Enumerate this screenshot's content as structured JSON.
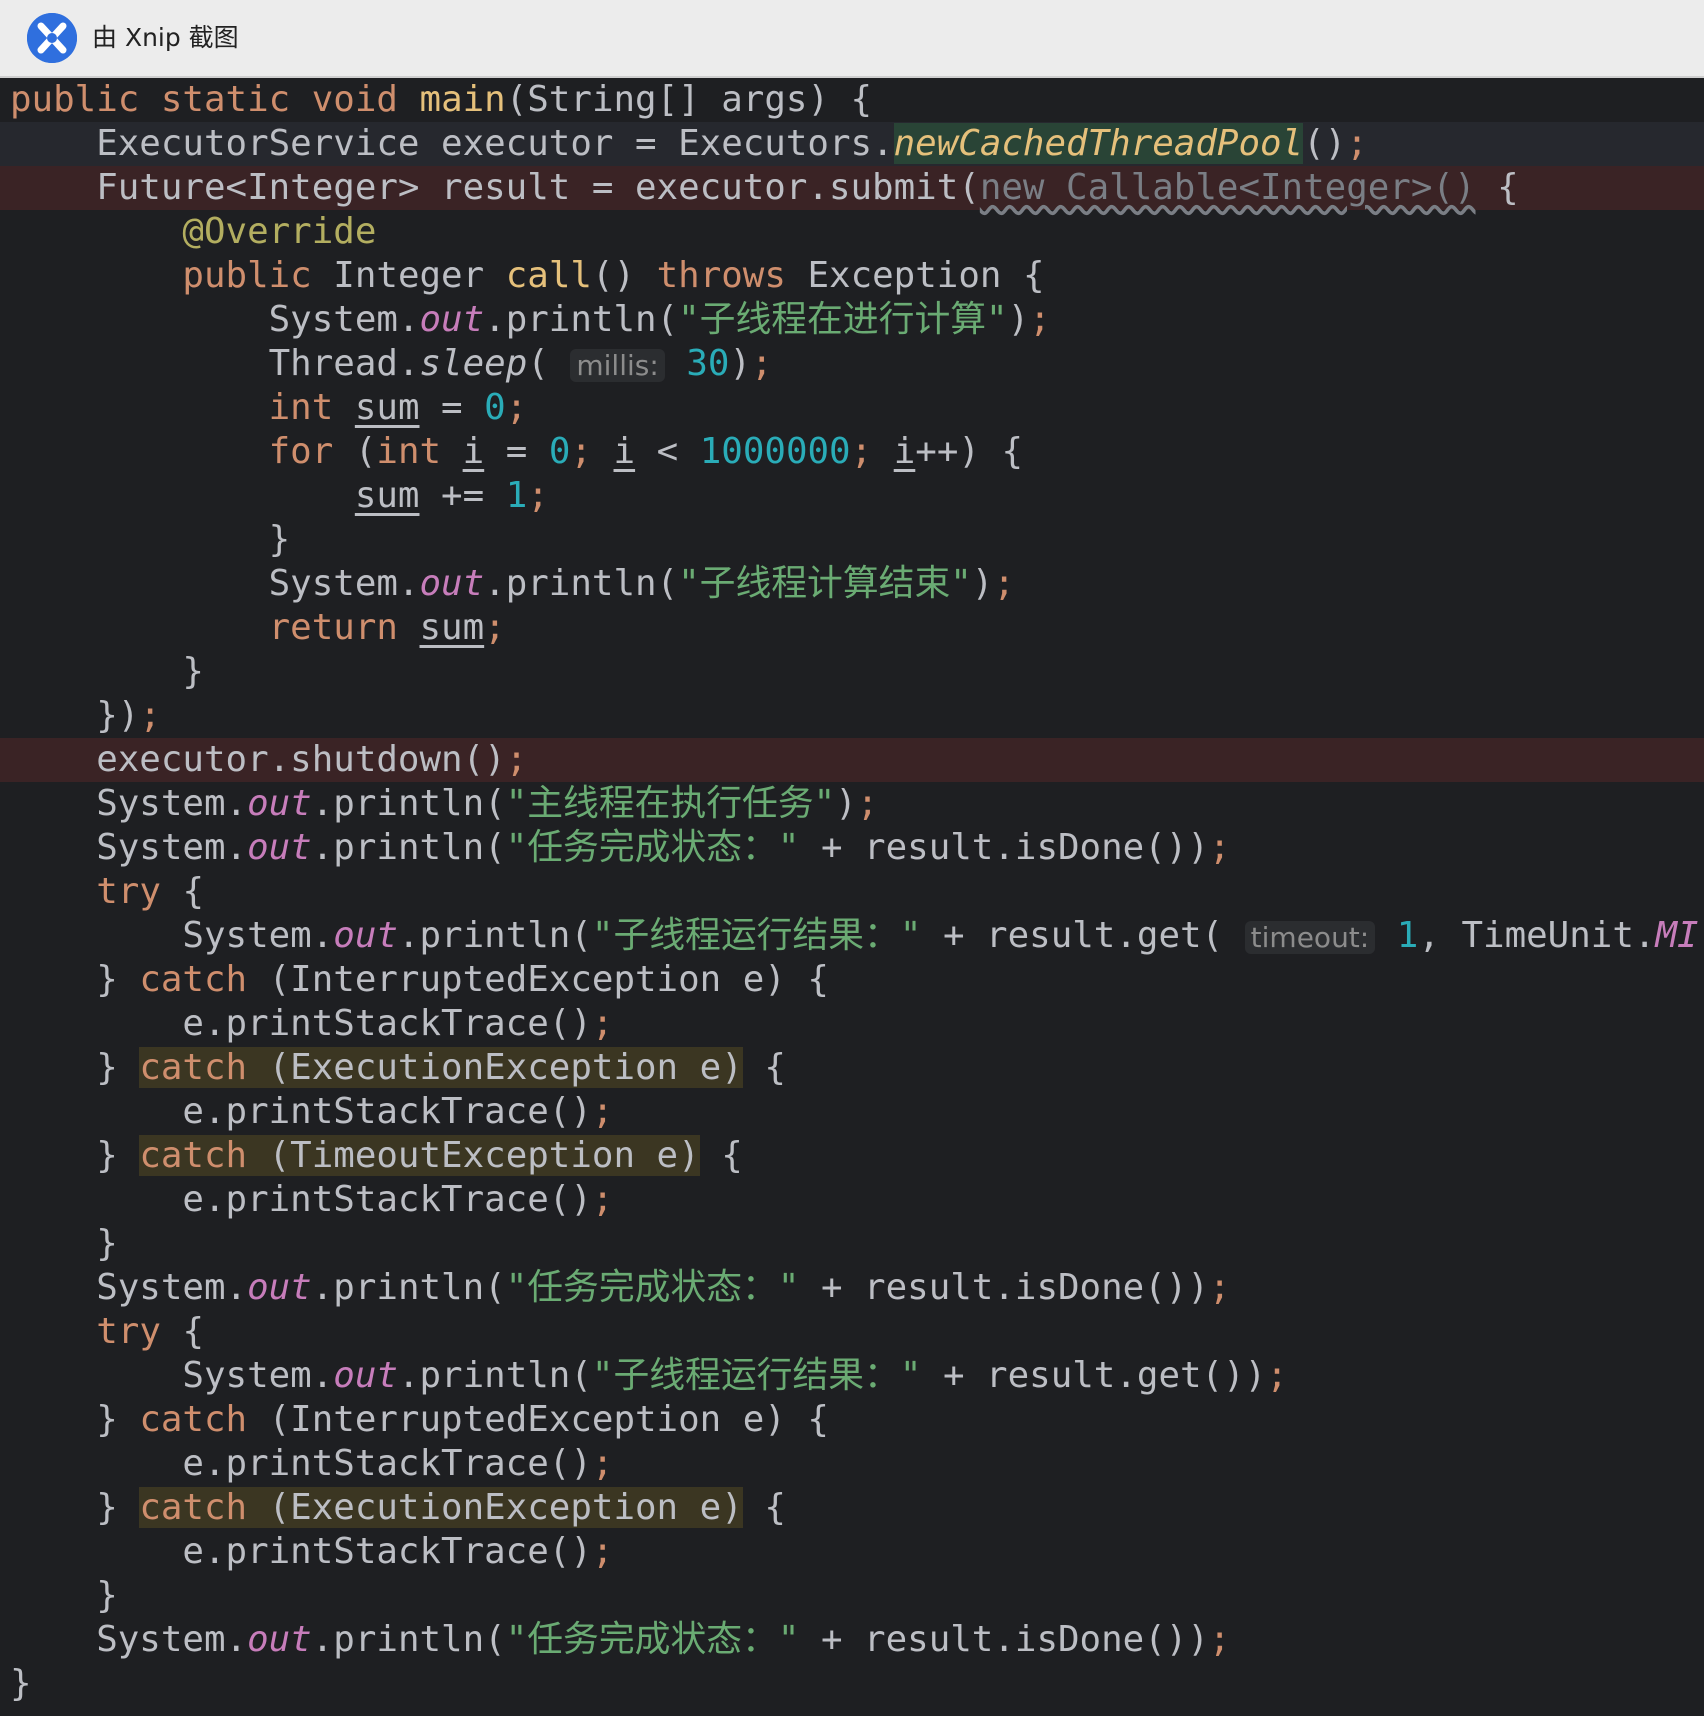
{
  "window": {
    "title": "由 Xnip 截图",
    "logo_icon": "xnip-logo-icon"
  },
  "code": {
    "l01": [
      "public ",
      "static ",
      "void ",
      "main",
      "(String[] args) {"
    ],
    "l02": [
      "    ExecutorService executor = Executors.",
      "newCachedThreadPool",
      "()",
      ";"
    ],
    "l03": [
      "    Future<Integer> result = executor.submit(",
      "new Callable<Integer>()",
      " {"
    ],
    "l04": [
      "        ",
      "@Override"
    ],
    "l05": [
      "        ",
      "public ",
      "Integer ",
      "call",
      "() ",
      "throws ",
      "Exception {"
    ],
    "l06": [
      "            System.",
      "out",
      ".println(",
      "\"子线程在进行计算\"",
      ")",
      ";"
    ],
    "l07": [
      "            Thread.",
      "sleep",
      "( ",
      "millis:",
      " ",
      "30",
      ")",
      ";"
    ],
    "l08": [
      "            ",
      "int ",
      "sum",
      " = ",
      "0",
      ";"
    ],
    "l09": [
      "            ",
      "for ",
      "(",
      "int ",
      "i",
      " = ",
      "0",
      "; ",
      "i",
      " < ",
      "1000000",
      "; ",
      "i",
      "++) {"
    ],
    "l10": [
      "                ",
      "sum",
      " += ",
      "1",
      ";"
    ],
    "l11": [
      "            }"
    ],
    "l12": [
      "            System.",
      "out",
      ".println(",
      "\"子线程计算结束\"",
      ")",
      ";"
    ],
    "l13": [
      "            ",
      "return ",
      "sum",
      ";"
    ],
    "l14": [
      "        }"
    ],
    "l15": [
      "    })",
      ";"
    ],
    "l16": [
      "    executor.shutdown()",
      ";"
    ],
    "l17": [
      "    System.",
      "out",
      ".println(",
      "\"主线程在执行任务\"",
      ")",
      ";"
    ],
    "l18": [
      "    System.",
      "out",
      ".println(",
      "\"任务完成状态：\"",
      " + result.isDone())",
      ";"
    ],
    "l19": [
      "    ",
      "try ",
      "{"
    ],
    "l20": [
      "        System.",
      "out",
      ".println(",
      "\"子线程运行结果：\"",
      " + result.get( ",
      "timeout:",
      " ",
      "1",
      ", TimeUnit.",
      "MI"
    ],
    "l21": [
      "    } ",
      "catch ",
      "(InterruptedException e) {"
    ],
    "l22": [
      "        e.printStackTrace()",
      ";"
    ],
    "l23": [
      "    } ",
      "catch ",
      "(ExecutionException e)",
      " {"
    ],
    "l24": [
      "        e.printStackTrace()",
      ";"
    ],
    "l25": [
      "    } ",
      "catch ",
      "(TimeoutException e)",
      " {"
    ],
    "l26": [
      "        e.printStackTrace()",
      ";"
    ],
    "l27": [
      "    }"
    ],
    "l28": [
      "    System.",
      "out",
      ".println(",
      "\"任务完成状态：\"",
      " + result.isDone())",
      ";"
    ],
    "l29": [
      "    ",
      "try ",
      "{"
    ],
    "l30": [
      "        System.",
      "out",
      ".println(",
      "\"子线程运行结果：\"",
      " + result.get())",
      ";"
    ],
    "l31": [
      "    } ",
      "catch ",
      "(InterruptedException e) {"
    ],
    "l32": [
      "        e.printStackTrace()",
      ";"
    ],
    "l33": [
      "    } ",
      "catch ",
      "(ExecutionException e)",
      " {"
    ],
    "l34": [
      "        e.printStackTrace()",
      ";"
    ],
    "l35": [
      "    }"
    ],
    "l36": [
      "    System.",
      "out",
      ".println(",
      "\"任务完成状态：\"",
      " + result.isDone())",
      ";"
    ],
    "l37": [
      "}"
    ]
  },
  "colors": {
    "background": "#1e1f22",
    "keyword": "#cf8e6d",
    "string": "#6aab73",
    "number": "#2aacb8",
    "annotation": "#b3ae60",
    "error_line": "#3a2325"
  }
}
